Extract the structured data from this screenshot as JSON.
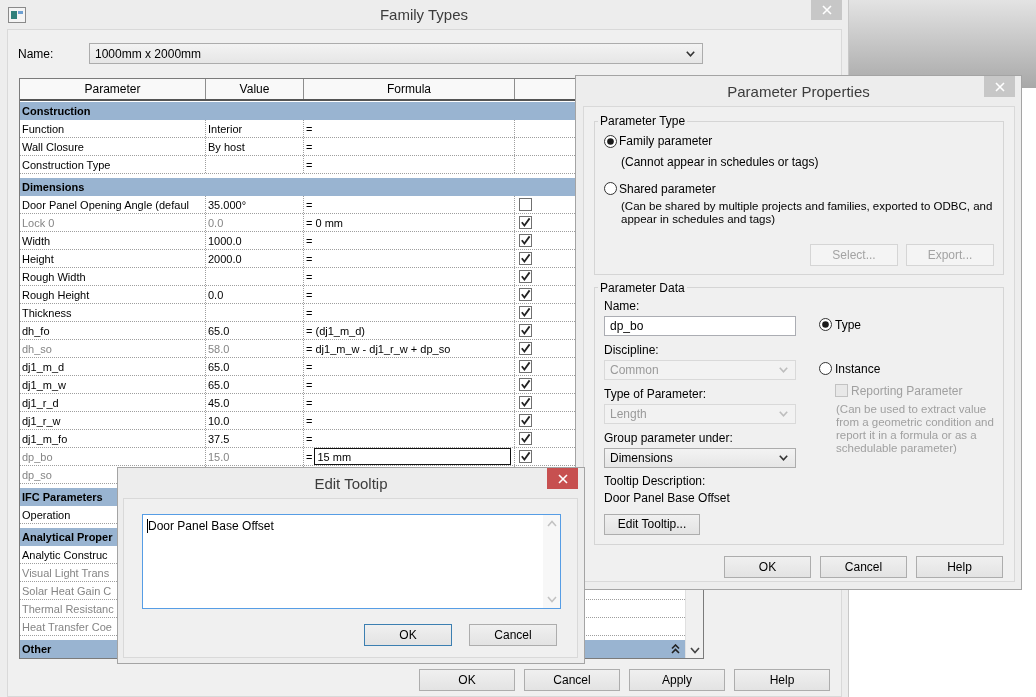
{
  "family_types": {
    "title": "Family Types",
    "name_label": "Name:",
    "type_name": "1000mm x 2000mm",
    "table": {
      "columns": [
        "Parameter",
        "Value",
        "Formula"
      ],
      "groups": [
        {
          "name": "Construction",
          "rows": [
            {
              "parameter": "Function",
              "value": "Interior",
              "formula": "=",
              "disabled": false
            },
            {
              "parameter": "Wall Closure",
              "value": "By host",
              "formula": "=",
              "disabled": false
            },
            {
              "parameter": "Construction Type",
              "formula": "=",
              "disabled": false
            }
          ]
        },
        {
          "name": "Dimensions",
          "rows": [
            {
              "parameter": "Door Panel Opening Angle (defaul",
              "value": "35.000°",
              "formula": "=",
              "locked": false,
              "disabled": false
            },
            {
              "parameter": "Lock 0",
              "value": "0.0",
              "formula": "= 0 mm",
              "locked": true,
              "disabled": true
            },
            {
              "parameter": "Width",
              "value": "1000.0",
              "formula": "=",
              "locked": true,
              "disabled": false
            },
            {
              "parameter": "Height",
              "value": "2000.0",
              "formula": "=",
              "locked": true,
              "disabled": false
            },
            {
              "parameter": "Rough Width",
              "formula": "=",
              "locked": true,
              "disabled": false
            },
            {
              "parameter": "Rough Height",
              "value": "0.0",
              "formula": "=",
              "locked": true,
              "disabled": false
            },
            {
              "parameter": "Thickness",
              "formula": "=",
              "locked": true,
              "disabled": false
            },
            {
              "parameter": "dh_fo",
              "value": "65.0",
              "formula": "= (dj1_m_d)",
              "locked": true,
              "disabled": false
            },
            {
              "parameter": "dh_so",
              "value": "58.0",
              "formula": "= dj1_m_w - dj1_r_w + dp_so",
              "locked": true,
              "disabled": true
            },
            {
              "parameter": "dj1_m_d",
              "value": "65.0",
              "formula": "=",
              "locked": true,
              "disabled": false
            },
            {
              "parameter": "dj1_m_w",
              "value": "65.0",
              "formula": "=",
              "locked": true,
              "disabled": false
            },
            {
              "parameter": "dj1_r_d",
              "value": "45.0",
              "formula": "=",
              "locked": true,
              "disabled": false
            },
            {
              "parameter": "dj1_r_w",
              "value": "10.0",
              "formula": "=",
              "locked": true,
              "disabled": false
            },
            {
              "parameter": "dj1_m_fo",
              "value": "37.5",
              "formula": "=",
              "locked": true,
              "disabled": false
            },
            {
              "parameter": "dp_bo",
              "value": "15.0",
              "formula": "=",
              "formula_input": "15 mm",
              "locked": true,
              "disabled": true
            },
            {
              "parameter": "dp_so",
              "disabled": true
            }
          ]
        },
        {
          "name": "IFC Parameters",
          "rows": [
            {
              "parameter": "Operation",
              "disabled": false
            }
          ]
        },
        {
          "name": "Analytical Proper",
          "rows": [
            {
              "parameter": "Analytic Construc",
              "disabled": false
            },
            {
              "parameter": "Visual Light Trans",
              "disabled": true
            },
            {
              "parameter": "Solar Heat Gain C",
              "disabled": true
            },
            {
              "parameter": "Thermal Resistanc",
              "disabled": true
            },
            {
              "parameter": "Heat Transfer Coe",
              "disabled": true
            }
          ]
        },
        {
          "name": "Other"
        }
      ]
    },
    "buttons": [
      "OK",
      "Cancel",
      "Apply",
      "Help"
    ]
  },
  "parameter_properties": {
    "title": "Parameter Properties",
    "parameter_type": {
      "legend": "Parameter Type",
      "options": [
        {
          "label": "Family parameter",
          "note": "(Cannot appear in schedules or tags)",
          "selected": true
        },
        {
          "label": "Shared parameter",
          "note": "(Can be shared by multiple projects and families, exported to ODBC, and appear in schedules and tags)",
          "selected": false
        }
      ],
      "buttons": [
        {
          "label": "Select...",
          "disabled": true
        },
        {
          "label": "Export...",
          "disabled": true
        }
      ]
    },
    "parameter_data": {
      "legend": "Parameter Data",
      "fields": [
        {
          "kind": "text",
          "label": "Name:",
          "value": "dp_bo",
          "disabled": false
        },
        {
          "kind": "select",
          "label": "Discipline:",
          "value": "Common",
          "disabled": true
        },
        {
          "kind": "select",
          "label": "Type of Parameter:",
          "value": "Length",
          "disabled": true
        },
        {
          "kind": "select",
          "label": "Group parameter under:",
          "value": "Dimensions",
          "disabled": false
        }
      ],
      "scope_options": [
        {
          "label": "Type",
          "selected": true
        },
        {
          "label": "Instance",
          "selected": false
        }
      ],
      "reporting": {
        "label": "Reporting Parameter",
        "checked": false,
        "disabled": true,
        "note": "(Can be used to extract value from a geometric condition and report it in a formula or as a schedulable parameter)"
      },
      "tooltip_label": "Tooltip Description:",
      "tooltip_text": "Door Panel Base Offset",
      "edit_tooltip_button": "Edit Tooltip..."
    },
    "buttons": [
      "OK",
      "Cancel",
      "Help"
    ]
  },
  "edit_tooltip": {
    "title": "Edit Tooltip",
    "text": "Door Panel Base Offset",
    "buttons": [
      {
        "label": "OK",
        "default": true
      },
      {
        "label": "Cancel",
        "default": false
      }
    ]
  }
}
